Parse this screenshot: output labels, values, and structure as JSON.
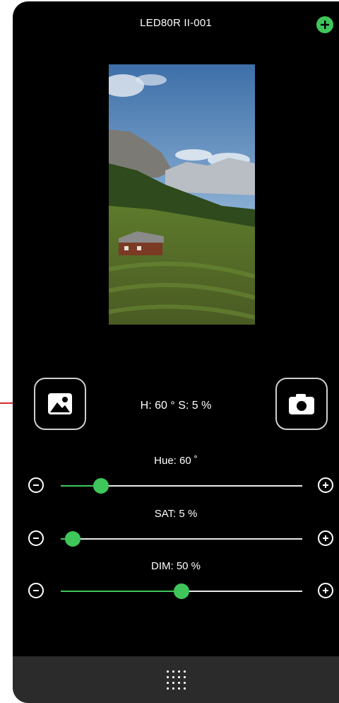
{
  "header": {
    "title": "LED80R II-001",
    "add_icon": "plus-circle-icon"
  },
  "preview": {
    "description_icon": "landscape-photo"
  },
  "controls": {
    "gallery_icon": "image-icon",
    "camera_icon": "camera-icon",
    "readout": "H:  60 ° S:  5 %"
  },
  "sliders": [
    {
      "key": "hue",
      "label": "Hue:  60 ˚",
      "value": 60,
      "max": 360
    },
    {
      "key": "sat",
      "label": "SAT:  5 %",
      "value": 5,
      "max": 100
    },
    {
      "key": "dim",
      "label": "DIM:  50 %",
      "value": 50,
      "max": 100
    }
  ],
  "footer": {
    "menu_icon": "grid-menu-icon"
  },
  "colors": {
    "accent": "#3fc65a",
    "background": "#000000",
    "bar": "#2b2b2b"
  }
}
